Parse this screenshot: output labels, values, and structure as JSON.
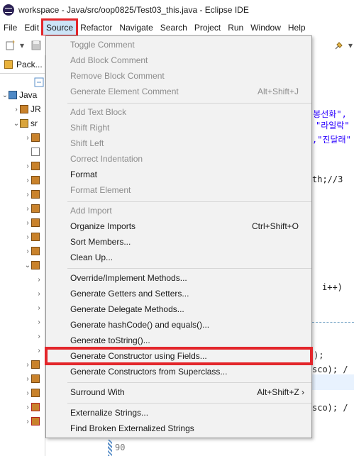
{
  "window": {
    "title": "workspace - Java/src/oop0825/Test03_this.java - Eclipse IDE"
  },
  "menubar": {
    "items": [
      {
        "label": "File"
      },
      {
        "label": "Edit"
      },
      {
        "label": "Source"
      },
      {
        "label": "Refactor"
      },
      {
        "label": "Navigate"
      },
      {
        "label": "Search"
      },
      {
        "label": "Project"
      },
      {
        "label": "Run"
      },
      {
        "label": "Window"
      },
      {
        "label": "Help"
      }
    ]
  },
  "toolbar": {
    "new_icon": "new-wizard-icon",
    "save_icon": "save-icon",
    "pin_icon": "pin-icon"
  },
  "package_explorer": {
    "tab_label": "Pack...",
    "tree": [
      {
        "label": "Java"
      },
      {
        "label": "JR"
      },
      {
        "label": "sr"
      }
    ]
  },
  "editor": {
    "code": [
      {
        "text": "\"봉선화\","
      },
      {
        "text": "\"라일락\""
      },
      {
        "text": ",\"진달래\""
      },
      {
        "text": "th;//3"
      },
      {
        "text": "i++)"
      },
      {
        "text": ");"
      },
      {
        "text": "sco); /"
      },
      {
        "text": "sco); /"
      }
    ],
    "line_number": "90"
  },
  "source_menu": {
    "groups": [
      [
        {
          "label": "Toggle Comment",
          "enabled": false,
          "shortcut": ""
        },
        {
          "label": "Add Block Comment",
          "enabled": false,
          "shortcut": ""
        },
        {
          "label": "Remove Block Comment",
          "enabled": false,
          "shortcut": ""
        },
        {
          "label": "Generate Element Comment",
          "enabled": false,
          "shortcut": "Alt+Shift+J"
        }
      ],
      [
        {
          "label": "Add Text Block",
          "enabled": false,
          "shortcut": ""
        },
        {
          "label": "Shift Right",
          "enabled": false,
          "shortcut": ""
        },
        {
          "label": "Shift Left",
          "enabled": false,
          "shortcut": ""
        },
        {
          "label": "Correct Indentation",
          "enabled": false,
          "shortcut": ""
        },
        {
          "label": "Format",
          "enabled": true,
          "shortcut": ""
        },
        {
          "label": "Format Element",
          "enabled": false,
          "shortcut": ""
        }
      ],
      [
        {
          "label": "Add Import",
          "enabled": false,
          "shortcut": ""
        },
        {
          "label": "Organize Imports",
          "enabled": true,
          "shortcut": "Ctrl+Shift+O"
        },
        {
          "label": "Sort Members...",
          "enabled": true,
          "shortcut": ""
        },
        {
          "label": "Clean Up...",
          "enabled": true,
          "shortcut": ""
        }
      ],
      [
        {
          "label": "Override/Implement Methods...",
          "enabled": true,
          "shortcut": ""
        },
        {
          "label": "Generate Getters and Setters...",
          "enabled": true,
          "shortcut": ""
        },
        {
          "label": "Generate Delegate Methods...",
          "enabled": true,
          "shortcut": ""
        },
        {
          "label": "Generate hashCode() and equals()...",
          "enabled": true,
          "shortcut": ""
        },
        {
          "label": "Generate toString()...",
          "enabled": true,
          "shortcut": ""
        },
        {
          "label": "Generate Constructor using Fields...",
          "enabled": true,
          "shortcut": ""
        },
        {
          "label": "Generate Constructors from Superclass...",
          "enabled": true,
          "shortcut": ""
        }
      ],
      [
        {
          "label": "Surround With",
          "enabled": true,
          "shortcut": "Alt+Shift+Z ›"
        }
      ],
      [
        {
          "label": "Externalize Strings...",
          "enabled": true,
          "shortcut": ""
        },
        {
          "label": "Find Broken Externalized Strings",
          "enabled": true,
          "shortcut": ""
        }
      ]
    ]
  },
  "colors": {
    "highlight_red": "#e3262b",
    "menu_bg": "#f2f2f2",
    "disabled_text": "#8c8c8c"
  }
}
